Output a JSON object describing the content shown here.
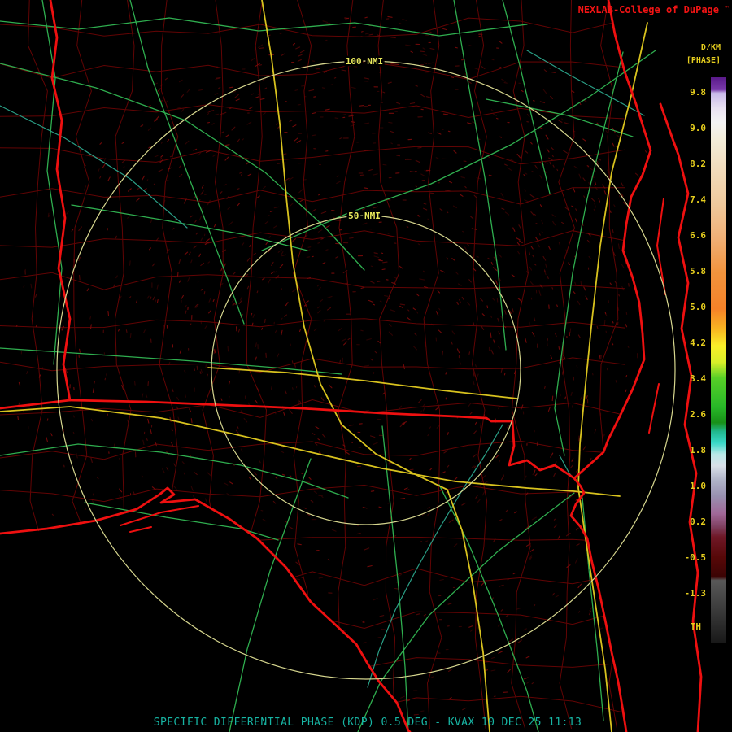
{
  "header": {
    "brand": "NEXLAB-College of DuPage",
    "mark": "™",
    "units": "D/KM",
    "product": "[PHASE]"
  },
  "rings": {
    "outer_label": "100 NMI",
    "inner_label": "50 NMI"
  },
  "colorbar": {
    "values": [
      "9.8",
      "9.0",
      "8.2",
      "7.4",
      "6.6",
      "5.8",
      "5.0",
      "4.2",
      "3.4",
      "2.6",
      "1.8",
      "1.0",
      "0.2",
      "-0.5",
      "-1.3"
    ],
    "threshold_label": "TH",
    "stops": [
      {
        "o": 0.0,
        "c": "#5a1a8a"
      },
      {
        "o": 0.022,
        "c": "#7a3aaa"
      },
      {
        "o": 0.028,
        "c": "#c9b9e9"
      },
      {
        "o": 0.055,
        "c": "#e9e1f1"
      },
      {
        "o": 0.08,
        "c": "#f3f3f3"
      },
      {
        "o": 0.11,
        "c": "#f3edd9"
      },
      {
        "o": 0.16,
        "c": "#f1dcbd"
      },
      {
        "o": 0.225,
        "c": "#efc99c"
      },
      {
        "o": 0.285,
        "c": "#f0af76"
      },
      {
        "o": 0.345,
        "c": "#f1933d"
      },
      {
        "o": 0.41,
        "c": "#f58228"
      },
      {
        "o": 0.447,
        "c": "#f8b821"
      },
      {
        "o": 0.475,
        "c": "#f9ef29"
      },
      {
        "o": 0.504,
        "c": "#d9ef29"
      },
      {
        "o": 0.532,
        "c": "#57cf27"
      },
      {
        "o": 0.583,
        "c": "#28b828"
      },
      {
        "o": 0.611,
        "c": "#189018"
      },
      {
        "o": 0.627,
        "c": "#21b890"
      },
      {
        "o": 0.647,
        "c": "#39d8c8"
      },
      {
        "o": 0.667,
        "c": "#b9e8e8"
      },
      {
        "o": 0.687,
        "c": "#d9e0e8"
      },
      {
        "o": 0.712,
        "c": "#b0b4c8"
      },
      {
        "o": 0.741,
        "c": "#9890b0"
      },
      {
        "o": 0.772,
        "c": "#a06898"
      },
      {
        "o": 0.795,
        "c": "#7f4060"
      },
      {
        "o": 0.813,
        "c": "#6f1827"
      },
      {
        "o": 0.849,
        "c": "#570808"
      },
      {
        "o": 0.884,
        "c": "#3b0404"
      },
      {
        "o": 0.89,
        "c": "#585858"
      },
      {
        "o": 0.935,
        "c": "#3f3f3f"
      },
      {
        "o": 1.0,
        "c": "#191919"
      }
    ]
  },
  "status_bar": {
    "text": "SPECIFIC DIFFERENTIAL PHASE (KDP) 0.5 DEG - KVAX 10 DEC 25 11:13"
  },
  "colors": {
    "background": "#000000",
    "state_border": "#ee1010",
    "county_line": "#620404",
    "interstate": "#d8c21e",
    "highway": "#2fae4f",
    "river": "#2a9f86",
    "range_ring": "#d6d68e",
    "ring_label": "#eaea5c",
    "brand_text": "#f21414",
    "scale_text": "#e6ce1e",
    "status_text": "#17b5a4",
    "echo_speckle": "#7c0a0a"
  }
}
